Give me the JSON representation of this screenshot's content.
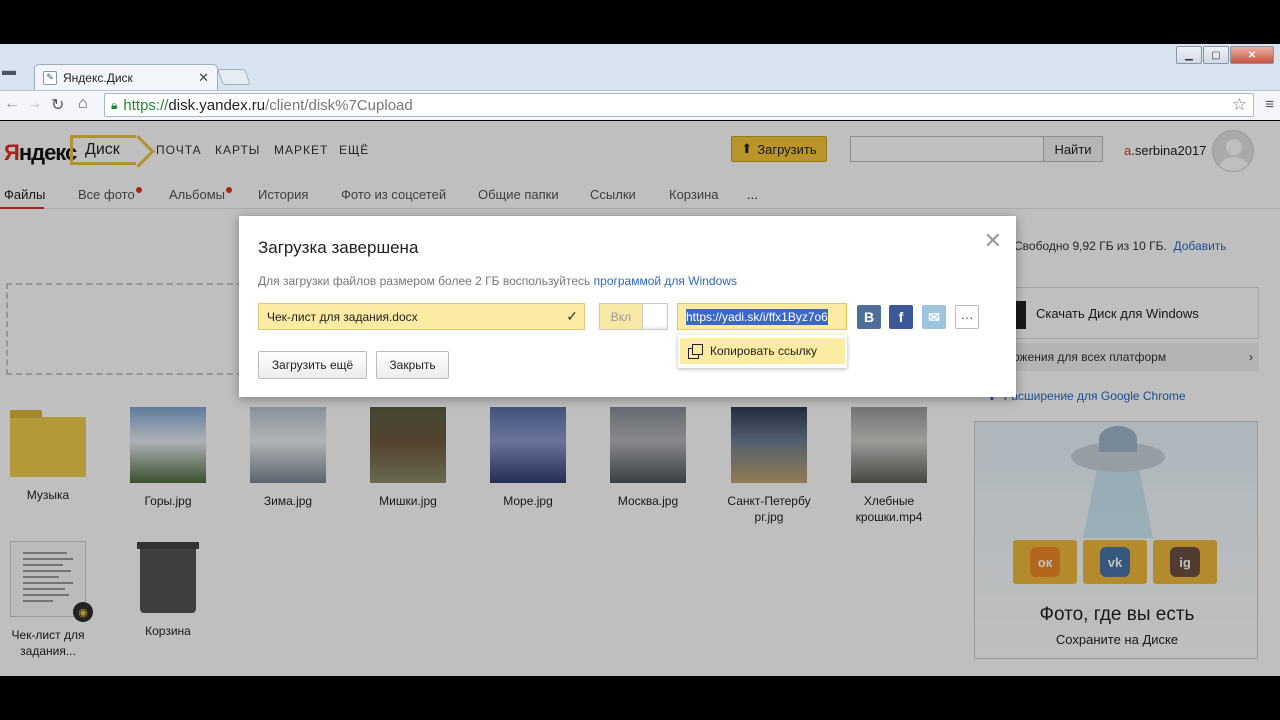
{
  "browser": {
    "tab_title": "Яндекс.Диск",
    "url_https": "https://",
    "url_host": "disk.yandex.ru",
    "url_path": "/client/disk%7Cupload"
  },
  "header": {
    "logo_red": "Я",
    "logo_rest": "ндекс",
    "disk_label": "Диск",
    "services": [
      "ПОЧТА",
      "КАРТЫ",
      "МАРКЕТ",
      "ЕЩЁ"
    ],
    "upload_label": "Загрузить",
    "search_placeholder": "",
    "search_button": "Найти",
    "user_first": "a",
    "user_rest": ".serbina2017"
  },
  "tabs": [
    {
      "label": "Файлы"
    },
    {
      "label": "Все фото"
    },
    {
      "label": "Альбомы"
    },
    {
      "label": "История"
    },
    {
      "label": "Фото из соцсетей"
    },
    {
      "label": "Общие папки"
    },
    {
      "label": "Ссылки"
    },
    {
      "label": "Корзина"
    },
    {
      "label": "..."
    }
  ],
  "files": [
    {
      "name": "Музыка",
      "kind": "folder"
    },
    {
      "name": "Горы.jpg",
      "kind": "image",
      "colors": [
        "#7fa4cf",
        "#e9eef4",
        "#4e6a3e"
      ]
    },
    {
      "name": "Зима.jpg",
      "kind": "image",
      "colors": [
        "#b7c3cf",
        "#ecf0f3",
        "#7a8794"
      ]
    },
    {
      "name": "Мишки.jpg",
      "kind": "image",
      "colors": [
        "#5b5f44",
        "#6e5840",
        "#8c8f6a"
      ]
    },
    {
      "name": "Море.jpg",
      "kind": "image",
      "colors": [
        "#5a6fa6",
        "#8d9bd0",
        "#2f3f73"
      ]
    },
    {
      "name": "Москва.jpg",
      "kind": "image",
      "colors": [
        "#8a8f98",
        "#b5b7bc",
        "#4d535a"
      ]
    },
    {
      "name": "Санкт-Петербург.jpg",
      "kind": "image",
      "colors": [
        "#2f3d52",
        "#6f7f95",
        "#c4a570"
      ]
    },
    {
      "name": "Хлебные крошки.mp4",
      "kind": "image",
      "colors": [
        "#9a9a98",
        "#d0d0cc",
        "#5e5e5a"
      ]
    },
    {
      "name": "Чек-лист для задания...",
      "kind": "doc"
    },
    {
      "name": "Корзина",
      "kind": "trash"
    }
  ],
  "sidebar": {
    "free_text": "Свободно 9,92 ГБ из 10 ГБ.",
    "add_link": "Добавить",
    "download_windows": "Скачать Диск для Windows",
    "apps_all": "ожения для всех платформ",
    "chrome_ext": "Расширение для Google Chrome",
    "promo_title": "Фото, где вы есть",
    "promo_sub": "Сохраните на Диске",
    "promo_icons": [
      "ок",
      "vk",
      "ig"
    ]
  },
  "dialog": {
    "title": "Загрузка завершена",
    "note": "Для загрузки файлов размером более 2 ГБ воспользуйтесь ",
    "note_link": "программой для Windows",
    "file_name": "Чек-лист для задания.docx",
    "toggle_label": "Вкл",
    "link_value": "https://yadi.sk/i/ffx1Byz7o6",
    "copy_label": "Копировать ссылку",
    "upload_more": "Загрузить ещё",
    "close": "Закрыть",
    "social": [
      {
        "name": "B",
        "color": "#4e6f99"
      },
      {
        "name": "f",
        "color": "#3b5998"
      },
      {
        "name": "✉",
        "color": "#9cc3e0"
      }
    ],
    "more": "···"
  }
}
